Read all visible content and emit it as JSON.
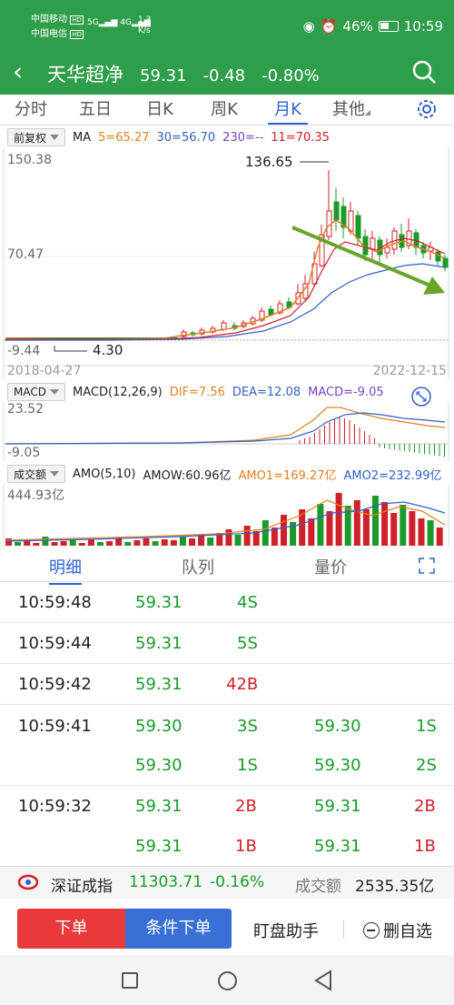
{
  "status": {
    "carrier1": "中国移动",
    "carrier2": "中国电信",
    "hd": "HD",
    "sig1": "5G",
    "sig2": "4G",
    "speed_val": "1.3",
    "speed_unit": "K/s",
    "battery": "46%",
    "time": "10:59"
  },
  "header": {
    "name": "天华超净",
    "price": "59.31",
    "change": "-0.48",
    "pct": "-0.80%"
  },
  "tabs": [
    "分时",
    "五日",
    "日K",
    "周K",
    "月K",
    "其他"
  ],
  "active_tab": "月K",
  "kline": {
    "adjust": "前复权",
    "ma_label": "MA",
    "ma5": "5=65.27",
    "ma30": "30=56.70",
    "ma230": "230=--",
    "ma11": "11=70.35",
    "y_top": "150.38",
    "y_mid": "70.47",
    "y_bot": "-9.44",
    "high_label": "136.65",
    "low_label": "4.30",
    "date_start": "2018-04-27",
    "date_end": "2022-12-15"
  },
  "macd": {
    "label": "MACD",
    "params": "MACD(12,26,9)",
    "dif": "DIF=7.56",
    "dea": "DEA=12.08",
    "macd": "MACD=-9.05",
    "y_top": "23.52",
    "y_bot": "-9.05"
  },
  "volume": {
    "label": "成交额",
    "params": "AMO(5,10)",
    "amow": "AMOW:60.96亿",
    "amo1": "AMO1=169.27亿",
    "amo2": "AMO2=232.99亿",
    "y_top": "444.93亿"
  },
  "detail_tabs": [
    "明细",
    "队列",
    "量价"
  ],
  "trades": [
    {
      "time": "10:59:48",
      "p1": "59.31",
      "v1": "4S",
      "p2": "",
      "v2": ""
    },
    {
      "time": "10:59:44",
      "p1": "59.31",
      "v1": "5S",
      "p2": "",
      "v2": ""
    },
    {
      "time": "10:59:42",
      "p1": "59.31",
      "v1": "42B",
      "p2": "",
      "v2": ""
    },
    {
      "time": "10:59:41",
      "p1": "59.30",
      "v1": "3S",
      "p2": "59.30",
      "v2": "1S"
    },
    {
      "time": "",
      "p1": "59.30",
      "v1": "1S",
      "p2": "59.30",
      "v2": "2S"
    },
    {
      "time": "10:59:32",
      "p1": "59.31",
      "v1": "2B",
      "p2": "59.31",
      "v2": "2B"
    },
    {
      "time": "",
      "p1": "59.31",
      "v1": "1B",
      "p2": "59.31",
      "v2": "1B"
    }
  ],
  "index": {
    "name": "深证成指",
    "value": "11303.71",
    "pct": "-0.16%",
    "amount_label": "成交额",
    "amount": "2535.35亿"
  },
  "actions": {
    "order": "下单",
    "cond_order": "条件下单",
    "assistant": "盯盘助手",
    "remove_watch": "删自选"
  },
  "colors": {
    "brand_green": "#2f9e4a",
    "up_red": "#d0202a",
    "down_green": "#1a9a2a",
    "accent_blue": "#2e63d1"
  }
}
